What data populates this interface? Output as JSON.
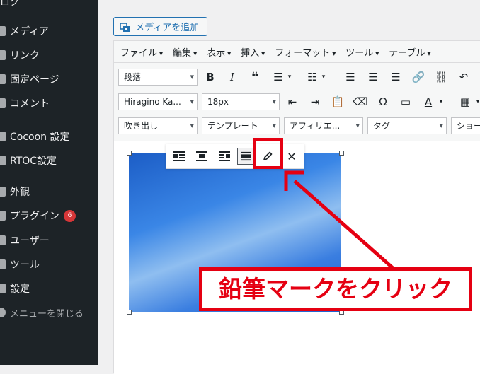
{
  "sidebar": {
    "top_partial": "ログ",
    "items": [
      {
        "label": "メディア",
        "icon": "media-icon"
      },
      {
        "label": "リンク",
        "icon": "link-icon"
      },
      {
        "label": "固定ページ",
        "icon": "page-icon"
      },
      {
        "label": "コメント",
        "icon": "comment-icon"
      },
      {
        "label": "Cocoon 設定",
        "icon": "cocoon-icon"
      },
      {
        "label": "RTOC設定",
        "icon": "rtoc-icon"
      },
      {
        "label": "外観",
        "icon": "appearance-icon"
      },
      {
        "label": "プラグイン",
        "icon": "plugin-icon",
        "badge": "6"
      },
      {
        "label": "ユーザー",
        "icon": "users-icon"
      },
      {
        "label": "ツール",
        "icon": "tools-icon"
      },
      {
        "label": "設定",
        "icon": "settings-icon"
      },
      {
        "label": "メニューを閉じる",
        "icon": "collapse-icon"
      }
    ]
  },
  "media_button": {
    "label": "メディアを追加"
  },
  "menubar": [
    "ファイル",
    "編集",
    "表示",
    "挿入",
    "フォーマット",
    "ツール",
    "テーブル"
  ],
  "toolbar": {
    "paragraph": "段落",
    "font_family": "Hiragino Ka...",
    "font_size": "18px",
    "balloon": "吹き出し",
    "template": "テンプレート",
    "affiliate": "アフィリエ...",
    "tag": "タグ",
    "shortcode_partial": "ショー"
  },
  "annotation": {
    "callout": "鉛筆マークをクリック"
  },
  "colors": {
    "accent": "#2271b1",
    "annotation_red": "#e50012",
    "sidebar_bg": "#1d2327"
  }
}
